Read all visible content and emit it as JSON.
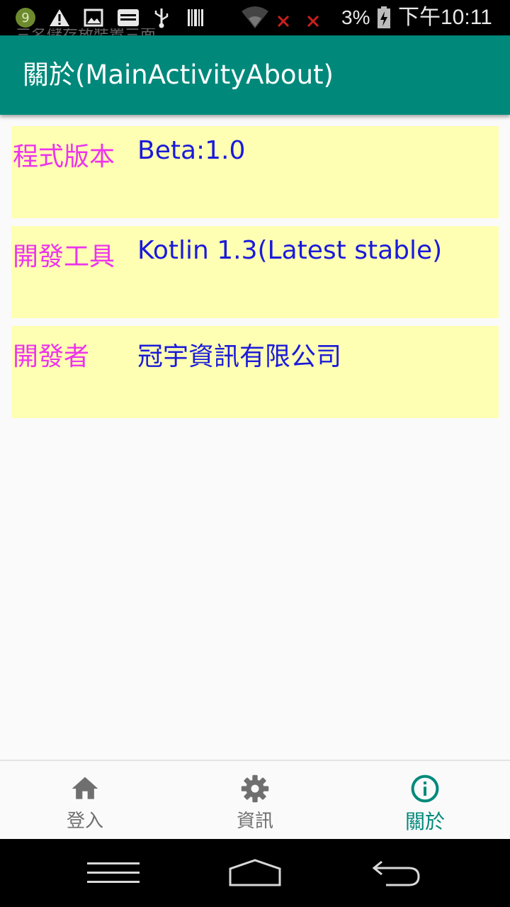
{
  "status_bar": {
    "battery_percent": "3%",
    "time": "下午10:11",
    "icons": [
      "app-notification-icon",
      "warning-icon",
      "image-icon",
      "ge-icon",
      "usb-icon",
      "barcode-icon",
      "wifi-off-icon",
      "signal-x-icon",
      "signal-x-icon",
      "battery-charging-icon"
    ]
  },
  "ghost_notification": "三名儲存放裝置三面",
  "app_bar": {
    "title": "關於(MainActivityAbout)",
    "color": "#00897b"
  },
  "info_rows": [
    {
      "label": "程式版本",
      "value": "Beta:1.0"
    },
    {
      "label": "開發工具",
      "value": "Kotlin 1.3(Latest stable)"
    },
    {
      "label": "開發者",
      "value": "冠宇資訊有限公司"
    }
  ],
  "colors": {
    "row_background": "#ffffb3",
    "label_color": "#ee33ee",
    "value_color": "#1a1adb",
    "nav_active": "#00897b",
    "nav_inactive": "#6f6f6f"
  },
  "bottom_nav": {
    "items": [
      {
        "label": "登入",
        "icon": "home-icon",
        "active": false
      },
      {
        "label": "資訊",
        "icon": "gear-icon",
        "active": false
      },
      {
        "label": "關於",
        "icon": "info-icon",
        "active": true
      }
    ]
  },
  "system_nav": {
    "buttons": [
      "menu-icon",
      "home-icon",
      "back-icon"
    ]
  }
}
